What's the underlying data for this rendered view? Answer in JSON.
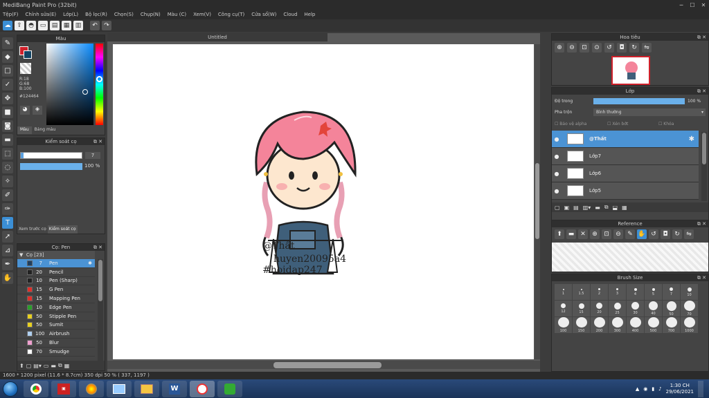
{
  "window": {
    "title": "MediBang Paint Pro (32bit)"
  },
  "menu": [
    "Tệp(F)",
    "Chỉnh sửa(E)",
    "Lớp(L)",
    "Bộ lọc(R)",
    "Chọn(S)",
    "Chụp(N)",
    "Màu (C)",
    "Xem(V)",
    "Công cụ(T)",
    "Cửa sổ(W)",
    "Cloud",
    "Help"
  ],
  "color_panel": {
    "title": "Màu",
    "r": "R:18",
    "g": "G:68",
    "b": "B:100",
    "hex": "#124464",
    "tab1": "Màu",
    "tab2": "Bảng màu",
    "fg": "#124464",
    "bg": "#ffffff"
  },
  "brush_control": {
    "title": "Kiểm soát cọ",
    "size": "7",
    "opacity": "100 %"
  },
  "left_tabs": {
    "tab1": "Xem trước cọ",
    "tab2": "Kiểm soát cọ"
  },
  "brush_panel": {
    "title": "Cọ: Pen",
    "group": "Cọ [23]",
    "items": [
      {
        "size": "7",
        "name": "Pen",
        "color": "#1e3e5e",
        "selected": true
      },
      {
        "size": "20",
        "name": "Pencil",
        "color": "#222222"
      },
      {
        "size": "10",
        "name": "Pen (Sharp)",
        "color": "#222222"
      },
      {
        "size": "15",
        "name": "G Pen",
        "color": "#e0302a"
      },
      {
        "size": "15",
        "name": "Mapping Pen",
        "color": "#e0302a"
      },
      {
        "size": "10",
        "name": "Edge Pen",
        "color": "#2aa02a"
      },
      {
        "size": "50",
        "name": "Stipple Pen",
        "color": "#e8d020"
      },
      {
        "size": "50",
        "name": "Sumit",
        "color": "#e8d020"
      },
      {
        "size": "100",
        "name": "Airbrush",
        "color": "#b0d0f0"
      },
      {
        "size": "50",
        "name": "Blur",
        "color": "#f0a0d0"
      },
      {
        "size": "70",
        "name": "Smudge",
        "color": "#ffffff"
      }
    ]
  },
  "document": {
    "tab": "Untitled"
  },
  "signature": {
    "line1": "@Thất",
    "line2": "huyen20095a4",
    "line3": "#hoidap247"
  },
  "navigator": {
    "title": "Hoa tiêu"
  },
  "layer_panel": {
    "title": "Lớp",
    "opacity_label": "Độ trong",
    "opacity_value": "100 %",
    "opacity_fraction": 1.0,
    "blend_label": "Pha trộn",
    "blend_value": "Bình thường",
    "protect_alpha": "Bảo vệ alpha",
    "clipping": "Xén bớt",
    "lock": "Khóa",
    "layers": [
      {
        "name": "@Thất",
        "selected": true
      },
      {
        "name": "Lớp7"
      },
      {
        "name": "Lớp6"
      },
      {
        "name": "Lớp5"
      }
    ]
  },
  "reference": {
    "title": "Reference"
  },
  "brush_size": {
    "title": "Brush Size",
    "sizes": [
      "1",
      "1.5",
      "2",
      "3",
      "4",
      "5",
      "7",
      "10",
      "12",
      "15",
      "20",
      "25",
      "30",
      "40",
      "50",
      "70",
      "100",
      "150",
      "200",
      "300",
      "400",
      "500",
      "700",
      "1000"
    ]
  },
  "status": {
    "text": "1600 * 1200 pixel   (11.6 * 8.7cm)   350 dpi   50 %   ( 337, 1197 )"
  },
  "tray": {
    "time": "1:30 CH",
    "date": "29/06/2021"
  },
  "colors": {
    "accent": "#3b8fd6",
    "hair": "#f4849a",
    "overall": "#3f5f7a"
  }
}
